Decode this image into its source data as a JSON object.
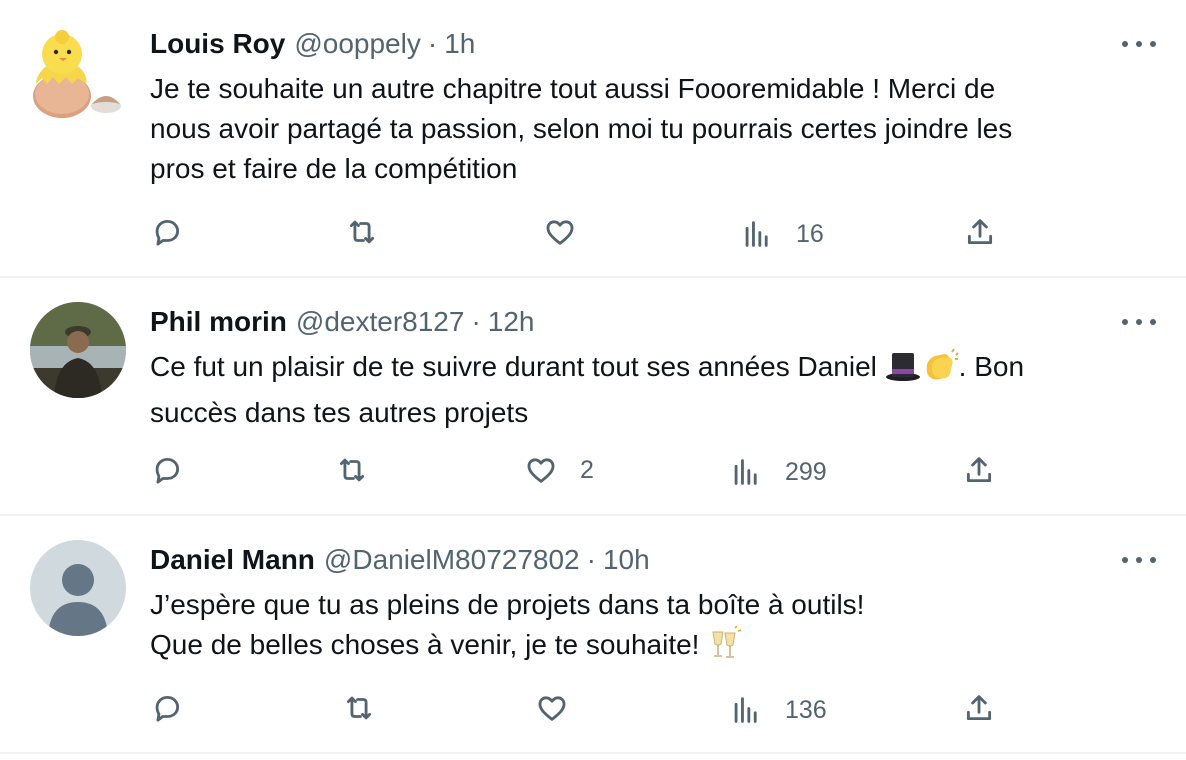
{
  "tweets": [
    {
      "name": "Louis Roy",
      "handle": "@ooppely",
      "separator": "·",
      "time": "1h",
      "text_lines": [
        "Je te souhaite un autre chapitre tout aussi Foooremidable ! Merci de",
        "nous avoir partagé ta passion, selon moi tu pourrais certes joindre les",
        "pros et faire de la compétition"
      ],
      "avatar": "chick-in-egg-avatar",
      "views": "16"
    },
    {
      "name": "Phil morin",
      "handle": "@dexter8127",
      "separator": "·",
      "time": "12h",
      "text_before_emoji": "Ce fut un plaisir de te suivre durant tout ses années Daniel ",
      "emojis": [
        "top-hat-emoji",
        "clapping-hands-emoji"
      ],
      "text_after_emoji": ". Bon",
      "text_line2": "succès dans tes autres projets",
      "avatar": "man-by-lake-avatar",
      "likes": "2",
      "views": "299"
    },
    {
      "name": "Daniel Mann",
      "handle": "@DanielM80727802",
      "separator": "·",
      "time": "10h",
      "text_line1": "J’espère que tu as pleins de projets dans ta boîte à outils!",
      "text_line2": "Que de belles choses à venir, je te souhaite! ",
      "emoji": "clinking-glasses-emoji",
      "avatar": "default-profile-avatar",
      "views": "136"
    }
  ]
}
